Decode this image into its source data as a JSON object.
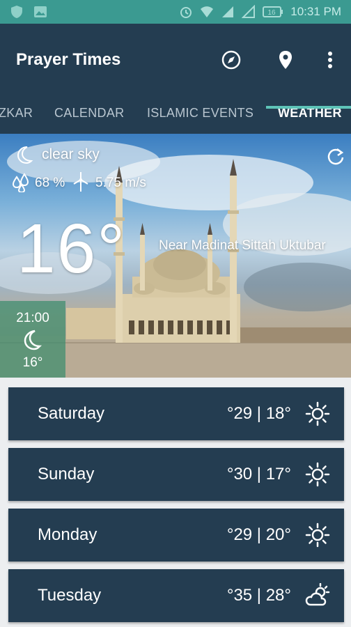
{
  "status_bar": {
    "time": "10:31 PM",
    "battery": "16",
    "icons": [
      "shield-icon",
      "image-icon",
      "alarm-icon",
      "wifi-icon",
      "signal-icon",
      "signal-icon",
      "battery-icon"
    ]
  },
  "app_bar": {
    "title": "Prayer Times",
    "actions": [
      "compass-icon",
      "location-pin-icon",
      "more-vert-icon"
    ]
  },
  "tabs": [
    {
      "label": "ZKAR",
      "active": false
    },
    {
      "label": "CALENDAR",
      "active": false
    },
    {
      "label": "ISLAMIC EVENTS",
      "active": false
    },
    {
      "label": "WEATHER",
      "active": true
    }
  ],
  "weather": {
    "condition": "clear sky",
    "humidity": "68 %",
    "wind": "5.75 m/s",
    "temperature": "16°",
    "location": "Near Madinat Sittah Uktubar",
    "hourly": {
      "time": "21:00",
      "temp": "16°",
      "icon": "moon-icon"
    }
  },
  "forecast": [
    {
      "day": "Saturday",
      "temps": "°29 | 18°",
      "icon": "sun-icon"
    },
    {
      "day": "Sunday",
      "temps": "°30 | 17°",
      "icon": "sun-icon"
    },
    {
      "day": "Monday",
      "temps": "°29 | 20°",
      "icon": "sun-icon"
    },
    {
      "day": "Tuesday",
      "temps": "°35 | 28°",
      "icon": "partly-cloudy-icon"
    }
  ],
  "colors": {
    "status_bar": "#3b9a91",
    "app_bar": "#243d51",
    "tab_indicator": "#5ec4b8",
    "card": "#243d51"
  }
}
